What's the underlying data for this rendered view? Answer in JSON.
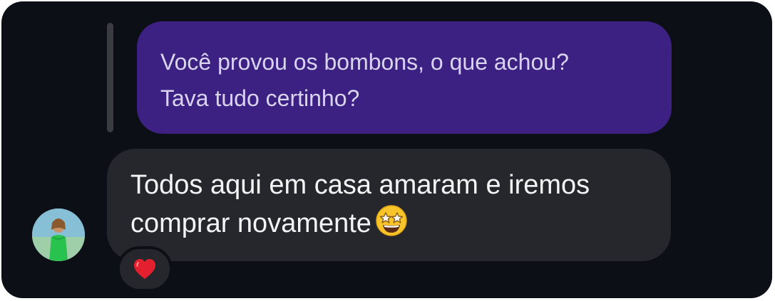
{
  "thread": {
    "quoted_message": {
      "text": "Você provou os bombons, o que achou?\nTava tudo certinho?"
    },
    "incoming_message": {
      "text": "Todos aqui em casa amaram e iremos comprar novamente",
      "emoji": "star-struck-emoji"
    },
    "reaction": {
      "emoji": "red-heart-icon"
    },
    "avatar": {
      "icon": "contact-avatar"
    }
  },
  "colors": {
    "background": "#0c1016",
    "reply_bubble": "#3c2182",
    "incoming_bubble": "#26272c",
    "text_light": "#f4f4f6"
  }
}
